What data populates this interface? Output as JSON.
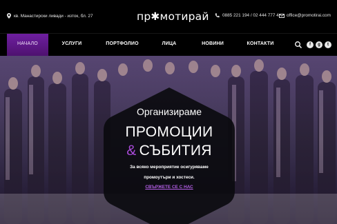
{
  "topbar": {
    "address": "кв. Манастирски ливади - изток, бл. 27",
    "address_icon": "map-pin-icon",
    "logo": "пр✱мотирай",
    "phone": "0885 221 194 / 02 444 777 4",
    "phone_icon": "phone-icon",
    "email": "office@promotirai.com",
    "email_icon": "envelope-icon"
  },
  "nav": {
    "items": [
      {
        "label": "НАЧАЛО",
        "active": true
      },
      {
        "label": "УСЛУГИ",
        "active": false
      },
      {
        "label": "ПОРТФОЛИО",
        "active": false
      },
      {
        "label": "ЛИЦА",
        "active": false
      },
      {
        "label": "НОВИНИ",
        "active": false
      },
      {
        "label": "КОНТАКТИ",
        "active": false
      }
    ],
    "search_icon": "search-icon",
    "social": [
      {
        "icon": "facebook-icon",
        "glyph": "f"
      },
      {
        "icon": "google-plus-icon",
        "glyph": "g"
      },
      {
        "icon": "twitter-icon",
        "glyph": "t"
      }
    ]
  },
  "hero": {
    "line1": "Организираме",
    "line2": "ПРОМОЦИИ",
    "amp": "&",
    "line3": "СЪБИТИЯ",
    "desc_line1": "За всяко мероприятие осигуряваме",
    "desc_line2": "промоутъри и хостеси.",
    "cta": "СВЪРЖЕТЕ СЕ С НАС"
  },
  "colors": {
    "accent": "#6a1b9a",
    "amp": "#a94bd8",
    "cta": "#b35ee6",
    "background": "#000000"
  }
}
